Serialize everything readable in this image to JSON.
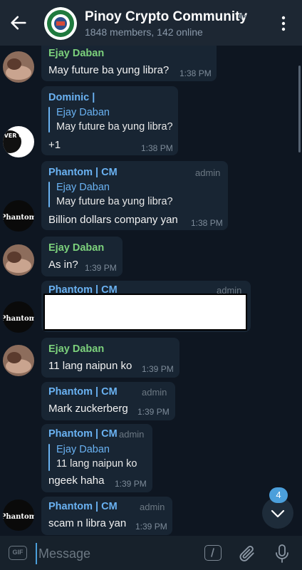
{
  "header": {
    "title": "Pinoy Crypto Community",
    "subtitle": "1848 members, 142 online"
  },
  "messages": [
    {
      "sender": "Ejay Daban",
      "text": "May future ba yung libra?",
      "time": "1:38 PM"
    },
    {
      "sender": "Dominic |",
      "reply_to": "Ejay Daban",
      "reply_text": "May future ba yung libra?",
      "text": "+1",
      "time": "1:38 PM",
      "avatar_text": "NEVER GIVE UP"
    },
    {
      "sender": "Phantom | CM",
      "role": "admin",
      "reply_to": "Ejay Daban",
      "reply_text": "May future ba yung libra?",
      "text": "Billion dollars company yan",
      "time": "1:38 PM",
      "avatar_text": "Phantom"
    },
    {
      "sender": "Ejay Daban",
      "text": "As in?",
      "time": "1:39 PM"
    },
    {
      "sender": "Phantom | CM",
      "role": "admin",
      "avatar_text": "Phantom"
    },
    {
      "sender": "Ejay Daban",
      "text": "11 lang naipun ko",
      "time": "1:39 PM"
    },
    {
      "sender": "Phantom | CM",
      "role": "admin",
      "text": "Mark zuckerberg",
      "time": "1:39 PM"
    },
    {
      "sender": "Phantom | CM",
      "role": "admin",
      "reply_to": "Ejay Daban",
      "reply_text": "11 lang naipun ko",
      "text": "ngeek haha",
      "time": "1:39 PM"
    },
    {
      "sender": "Phantom | CM",
      "role": "admin",
      "text": "scam n libra yan",
      "time": "1:39 PM",
      "avatar_text": "Phantom"
    }
  ],
  "scroll_down": {
    "unread_count": "4"
  },
  "composer": {
    "placeholder": "Message",
    "gif_label": "GIF"
  },
  "colors": {
    "background": "#0e1621",
    "header": "#1d2733",
    "bubble": "#182533",
    "sender_green": "#7cd17c",
    "sender_blue": "#6ab2f2",
    "accent": "#4b9fdb"
  }
}
